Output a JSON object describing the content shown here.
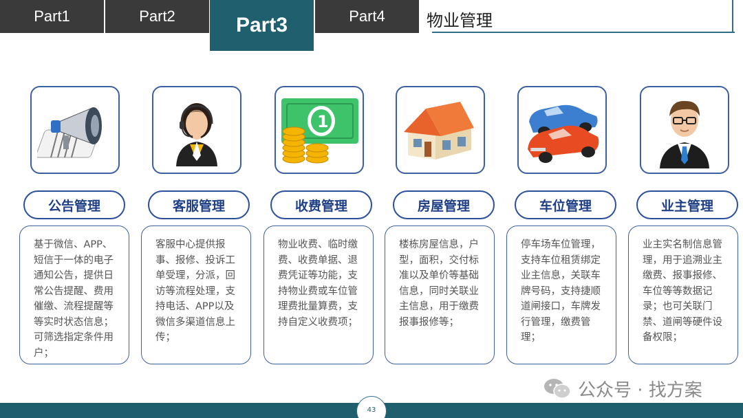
{
  "tabs": [
    {
      "label": "Part1"
    },
    {
      "label": "Part2"
    },
    {
      "label": "Part3"
    },
    {
      "label": "Part4"
    }
  ],
  "section_title": "物业管理",
  "modules": [
    {
      "title": "公告管理",
      "icon": "megaphone-icon",
      "desc": "基于微信、APP、短信于一体的电子通知公告，提供日常公告提醒、费用催缴、流程提醒等等实时状态信息；可筛选指定条件用户；"
    },
    {
      "title": "客服管理",
      "icon": "customer-service-agent-icon",
      "desc": "客服中心提供报事、报修、投诉工单受理，分派，回访等流程处理，支持电话、APP以及微信多渠道信息上传；"
    },
    {
      "title": "收费管理",
      "icon": "money-coins-icon",
      "desc": "物业收费、临时缴费、收费单据、退费凭证等功能，支持物业费或车位管理费批量算费，支持自定义收费项；"
    },
    {
      "title": "房屋管理",
      "icon": "house-icon",
      "desc": "楼栋房屋信息，户型，面积，交付标准以及单价等基础信息，同时关联业主信息，用于缴费报事报修等；"
    },
    {
      "title": "车位管理",
      "icon": "cars-icon",
      "desc": "停车场车位管理，支持车位租赁绑定业主信息，关联车牌号码，支持捷顺道闸接口，车牌发行管理，缴费管理；"
    },
    {
      "title": "业主管理",
      "icon": "owner-businessman-icon",
      "desc": "业主实名制信息管理，用于追溯业主缴费、报事报修、车位等等数据记录；也可关联门禁、道闸等硬件设备权限；"
    }
  ],
  "page_number": "43",
  "watermark": {
    "text": "公众号 · 找方案",
    "icon": "wechat-icon"
  },
  "colors": {
    "active_tab": "#1f5f6e",
    "tab": "#3a3a3a",
    "accent_blue": "#2b4f9b"
  }
}
